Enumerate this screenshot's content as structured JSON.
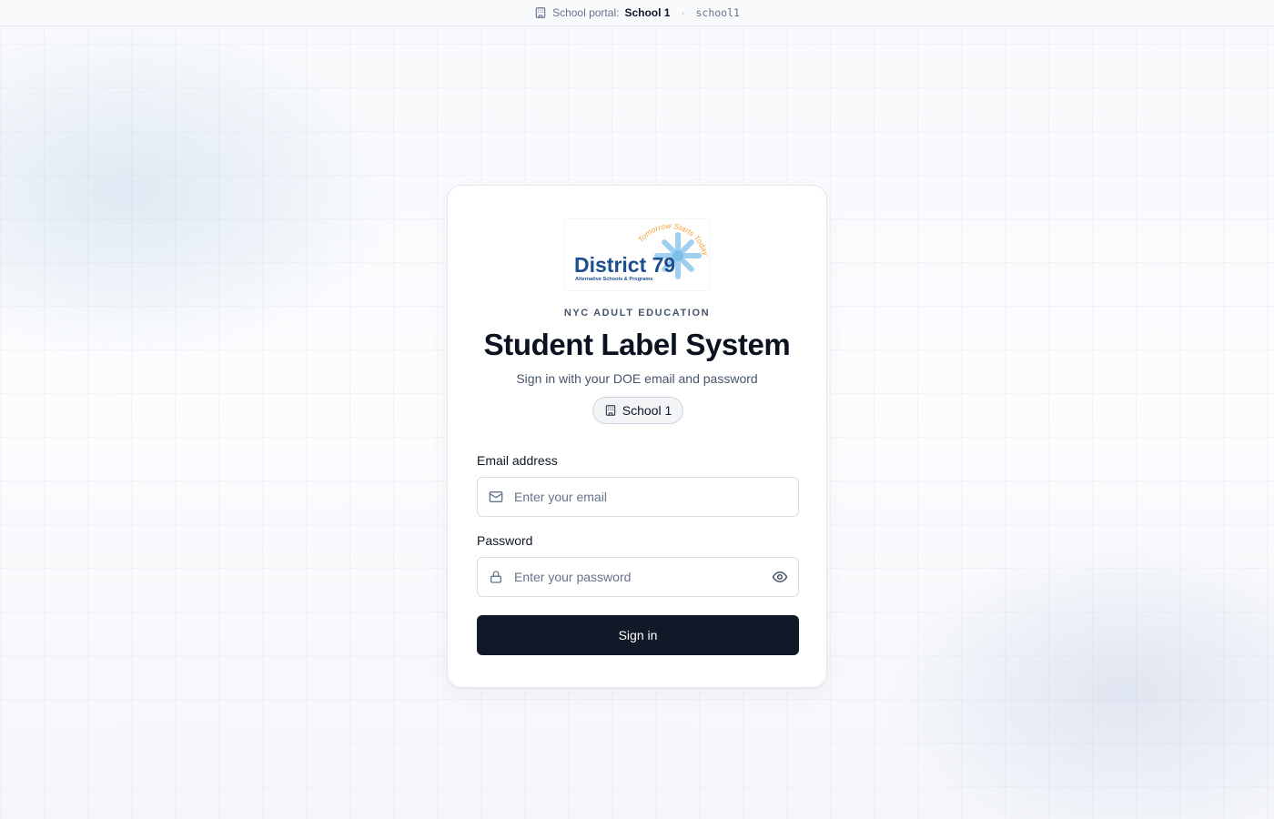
{
  "topbar": {
    "prefix": "School portal:",
    "school_name": "School 1",
    "separator": "·",
    "slug": "school1"
  },
  "card": {
    "logo": {
      "alt": "District 79 logo",
      "main_text": "District 79",
      "tagline": "Alternative Schools & Programs",
      "arc_text": "Tomorrow Starts Today"
    },
    "eyebrow": "NYC ADULT EDUCATION",
    "title": "Student Label System",
    "subtitle": "Sign in with your DOE email and password",
    "school_chip": "School 1"
  },
  "form": {
    "email": {
      "label": "Email address",
      "placeholder": "Enter your email",
      "value": ""
    },
    "password": {
      "label": "Password",
      "placeholder": "Enter your password",
      "value": ""
    },
    "submit_label": "Sign in"
  },
  "colors": {
    "primary_button": "#111827",
    "logo_blue": "#1c4f8f",
    "logo_light_blue": "#8ec6ec",
    "logo_orange": "#f2a23a"
  },
  "icons": {
    "topbar": "building-icon",
    "chip": "building-icon",
    "email": "mail-icon",
    "password": "lock-icon",
    "toggle": "eye-icon"
  }
}
